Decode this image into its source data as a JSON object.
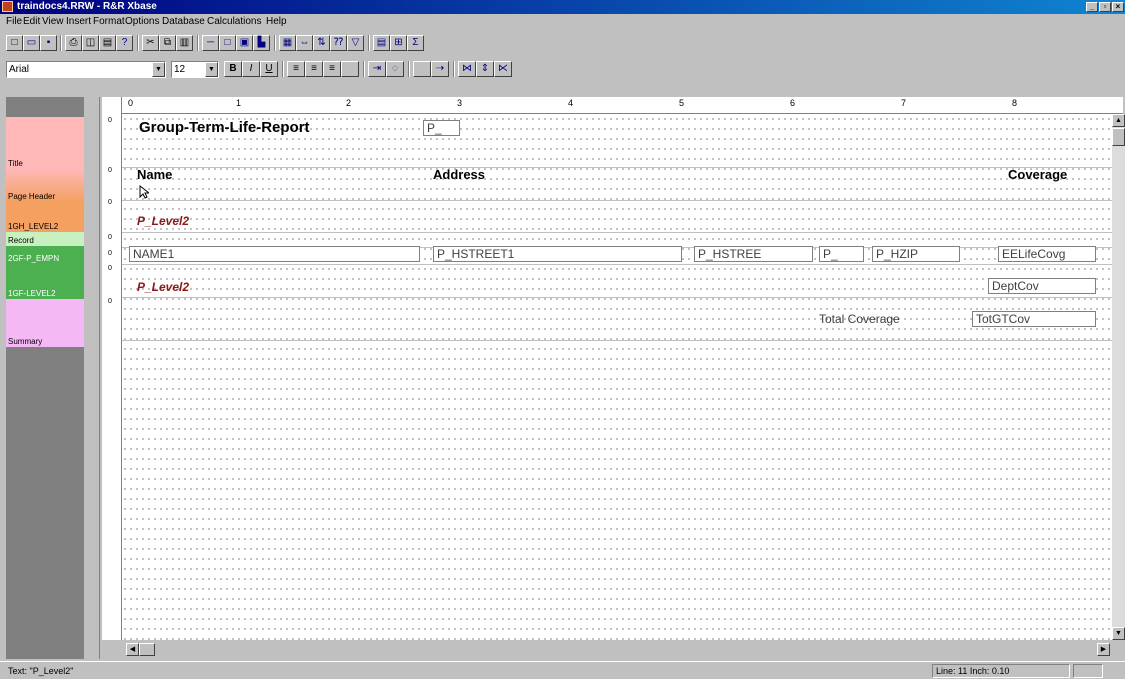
{
  "window": {
    "title": "traindocs4.RRW - R&R Xbase",
    "minimize": "_",
    "maximize": "▫",
    "close": "×"
  },
  "menu": [
    "File",
    "Edit",
    "View",
    "Insert",
    "Format",
    "Options",
    "Database",
    "Calculations",
    "Help"
  ],
  "toolbar_icons": [
    "new-icon",
    "open-icon",
    "save-icon",
    "print-icon",
    "print-preview-icon",
    "page-setup-icon",
    "help-icon",
    "cut-icon",
    "copy-icon",
    "paste-icon",
    "line-icon",
    "box-icon",
    "picture-icon",
    "chart-icon",
    "table-icon",
    "link-icon",
    "sort-icon",
    "query-icon",
    "filter-icon",
    "field-icon",
    "field-list-icon",
    "sum-icon"
  ],
  "format": {
    "font": "Arial",
    "size": "12",
    "bold": "B",
    "italic": "I",
    "underline": "U"
  },
  "bands": [
    {
      "label": "Title",
      "color": "#ffb8b8"
    },
    {
      "label": "Page Header",
      "color": "#f4a060"
    },
    {
      "label": "1GH_LEVEL2",
      "color": "#f4a060"
    },
    {
      "label": "Record",
      "color": "#c8f0c0"
    },
    {
      "label": "2GF-P_EMPN",
      "color": "#4caf50"
    },
    {
      "label": "1GF-LEVEL2",
      "color": "#4caf50"
    },
    {
      "label": "Summary",
      "color": "#f4b8f4"
    }
  ],
  "ruler": [
    "0",
    "1",
    "2",
    "3",
    "4",
    "5",
    "6",
    "7",
    "8"
  ],
  "report": {
    "title": "Group-Term-Life-Report",
    "title_field": "P_",
    "col_name": "Name",
    "col_address": "Address",
    "col_coverage": "Coverage",
    "group_header": "P_Level2",
    "fields": {
      "name": "NAME1",
      "street1": "P_HSTREET1",
      "street2": "P_HSTREE",
      "state": "P_",
      "zip": "P_HZIP",
      "coverage": "EELifeCovg"
    },
    "group_footer": "P_Level2",
    "dept_cov": "DeptCov",
    "total_label": "Total Coverage",
    "total_field": "TotGTCov"
  },
  "status": {
    "text": "Text: \"P_Level2\"",
    "position": "Line: 11  Inch: 0.10"
  }
}
